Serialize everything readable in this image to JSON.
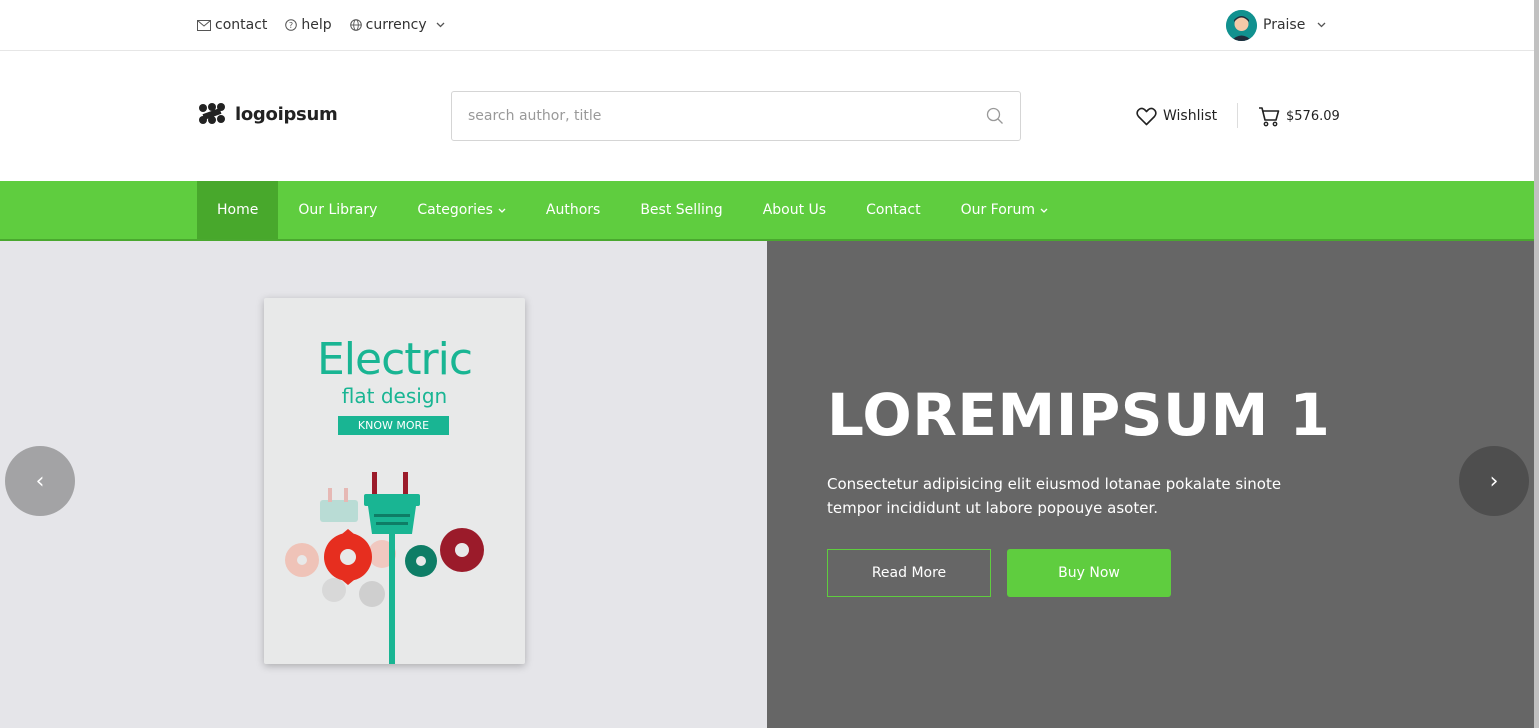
{
  "topbar": {
    "contact": "contact",
    "help": "help",
    "currency": "currency",
    "user_name": "Praise"
  },
  "header": {
    "logo_text": "logoipsum",
    "search_placeholder": "search author, title",
    "wishlist_label": "Wishlist",
    "cart_total": "$576.09"
  },
  "nav": {
    "items": [
      {
        "label": "Home"
      },
      {
        "label": "Our Library"
      },
      {
        "label": "Categories"
      },
      {
        "label": "Authors"
      },
      {
        "label": "Best Selling"
      },
      {
        "label": "About Us"
      },
      {
        "label": "Contact"
      },
      {
        "label": "Our Forum"
      }
    ]
  },
  "hero": {
    "book": {
      "title": "Electric",
      "subtitle": "flat design",
      "button": "KNOW MORE"
    },
    "title": "LOREMIPSUM 1",
    "description": "Consectetur adipisicing elit eiusmod lotanae pokalate sinote tempor incididunt ut labore popouye asoter.",
    "read_more": "Read More",
    "buy_now": "Buy Now",
    "prev_glyph": "‹",
    "next_glyph": "›"
  },
  "colors": {
    "accent": "#5fcd3f",
    "accent_dark": "#48a82c",
    "hero_dark": "#666666",
    "hero_light": "#e5e5e9",
    "book_teal": "#19b593"
  }
}
